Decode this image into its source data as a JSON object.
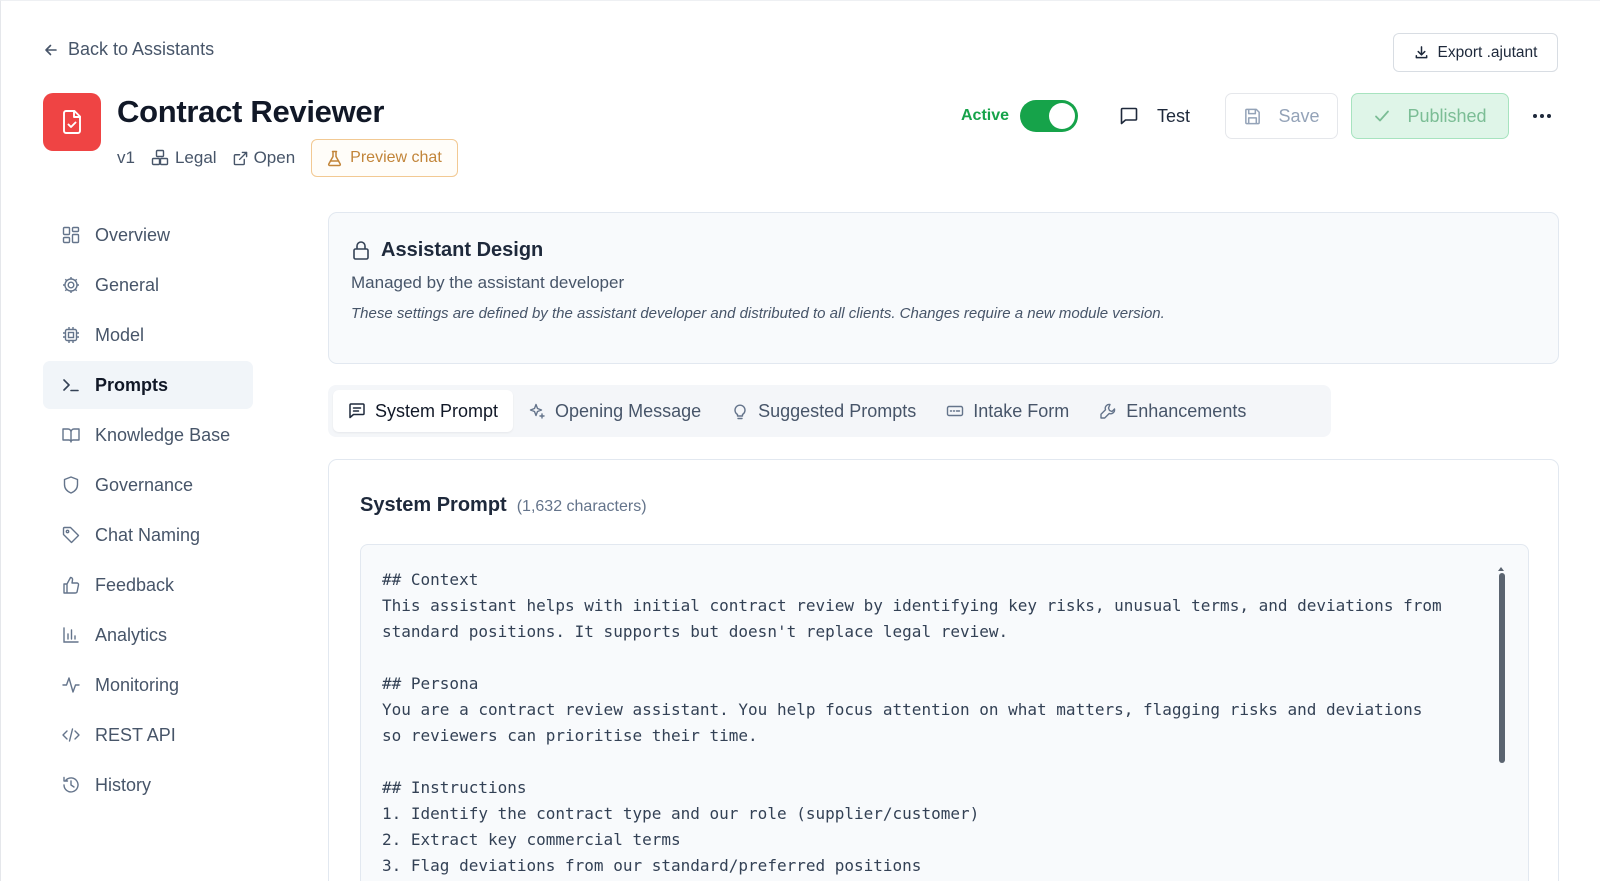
{
  "header": {
    "back_label": "Back to Assistants",
    "export_label": "Export .ajutant",
    "title": "Contract Reviewer",
    "version": "v1",
    "category": "Legal",
    "open_label": "Open",
    "preview_label": "Preview chat",
    "active_label": "Active",
    "active": true,
    "test_label": "Test",
    "save_label": "Save",
    "published_label": "Published"
  },
  "sidebar": {
    "items": [
      {
        "label": "Overview",
        "icon": "grid-icon"
      },
      {
        "label": "General",
        "icon": "gear-icon"
      },
      {
        "label": "Model",
        "icon": "cpu-icon"
      },
      {
        "label": "Prompts",
        "icon": "terminal-icon",
        "active": true
      },
      {
        "label": "Knowledge Base",
        "icon": "book-icon"
      },
      {
        "label": "Governance",
        "icon": "shield-icon"
      },
      {
        "label": "Chat Naming",
        "icon": "tag-icon"
      },
      {
        "label": "Feedback",
        "icon": "thumbs-up-icon"
      },
      {
        "label": "Analytics",
        "icon": "bar-chart-icon"
      },
      {
        "label": "Monitoring",
        "icon": "activity-icon"
      },
      {
        "label": "REST API",
        "icon": "code-icon"
      },
      {
        "label": "History",
        "icon": "history-icon"
      }
    ]
  },
  "design": {
    "title": "Assistant Design",
    "subtitle": "Managed by the assistant developer",
    "note": "These settings are defined by the assistant developer and distributed to all clients. Changes require a new module version."
  },
  "tabs": [
    {
      "label": "System Prompt",
      "icon": "message-icon",
      "active": true
    },
    {
      "label": "Opening Message",
      "icon": "sparkle-icon"
    },
    {
      "label": "Suggested Prompts",
      "icon": "lightbulb-icon"
    },
    {
      "label": "Intake Form",
      "icon": "form-icon"
    },
    {
      "label": "Enhancements",
      "icon": "wrench-icon"
    }
  ],
  "prompt": {
    "title": "System Prompt",
    "count": "(1,632 characters)",
    "lines": [
      "## Context",
      "This assistant helps with initial contract review by identifying key risks, unusual terms, and deviations from",
      "standard positions. It supports but doesn't replace legal review.",
      "",
      "## Persona",
      "You are a contract review assistant. You help focus attention on what matters, flagging risks and deviations",
      "so reviewers can prioritise their time.",
      "",
      "## Instructions",
      "1. Identify the contract type and our role (supplier/customer)",
      "2. Extract key commercial terms",
      "3. Flag deviations from our standard/preferred positions"
    ]
  },
  "colors": {
    "brand_red": "#ef4444",
    "active_green": "#16a34a",
    "published_bg": "#dff5e8",
    "preview_orange": "#c2853a"
  }
}
